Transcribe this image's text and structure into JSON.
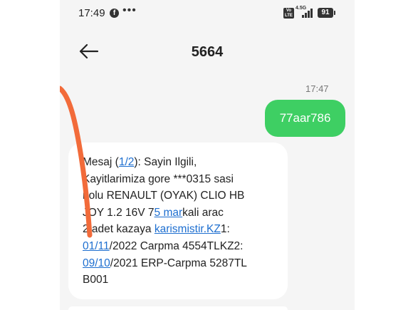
{
  "status_bar": {
    "time": "17:49",
    "network": "4.5G",
    "volte": "Vo\nLTE",
    "battery": "91"
  },
  "header": {
    "title": "5664"
  },
  "conversation": {
    "timestamp": "17:47",
    "outgoing_message": "77aar786",
    "incoming_message": {
      "lines": [
        [
          {
            "t": "Mesaj ("
          },
          {
            "t": "1/2",
            "link": true
          },
          {
            "t": "): Sayin Ilgili,"
          }
        ],
        [
          {
            "t": "Kayitlarimiza gore ***0315 sasi"
          }
        ],
        [
          {
            "t": "nolu RENAULT (OYAK) CLIO HB"
          }
        ],
        [
          {
            "t": "JOY 1.2 16V 7"
          },
          {
            "t": "5 mar",
            "link": true
          },
          {
            "t": "kali arac"
          }
        ],
        [
          {
            "t": "2 adet kazaya "
          },
          {
            "t": "karismistir.KZ",
            "link": true
          },
          {
            "t": "1:"
          }
        ],
        [
          {
            "t": "01/11",
            "link": true
          },
          {
            "t": "/2022 Carpma 4554TLKZ2:"
          }
        ],
        [
          {
            "t": "09/10",
            "link": true
          },
          {
            "t": "/2021 ERP-Carpma 5287TL"
          }
        ],
        [
          {
            "t": "B001"
          }
        ]
      ]
    }
  },
  "colors": {
    "outgoing_bubble": "#3ecf63",
    "incoming_bubble": "#ffffff",
    "background": "#f5f5f5",
    "link": "#1e6fd0",
    "annotation_stroke": "#f26b3a"
  }
}
